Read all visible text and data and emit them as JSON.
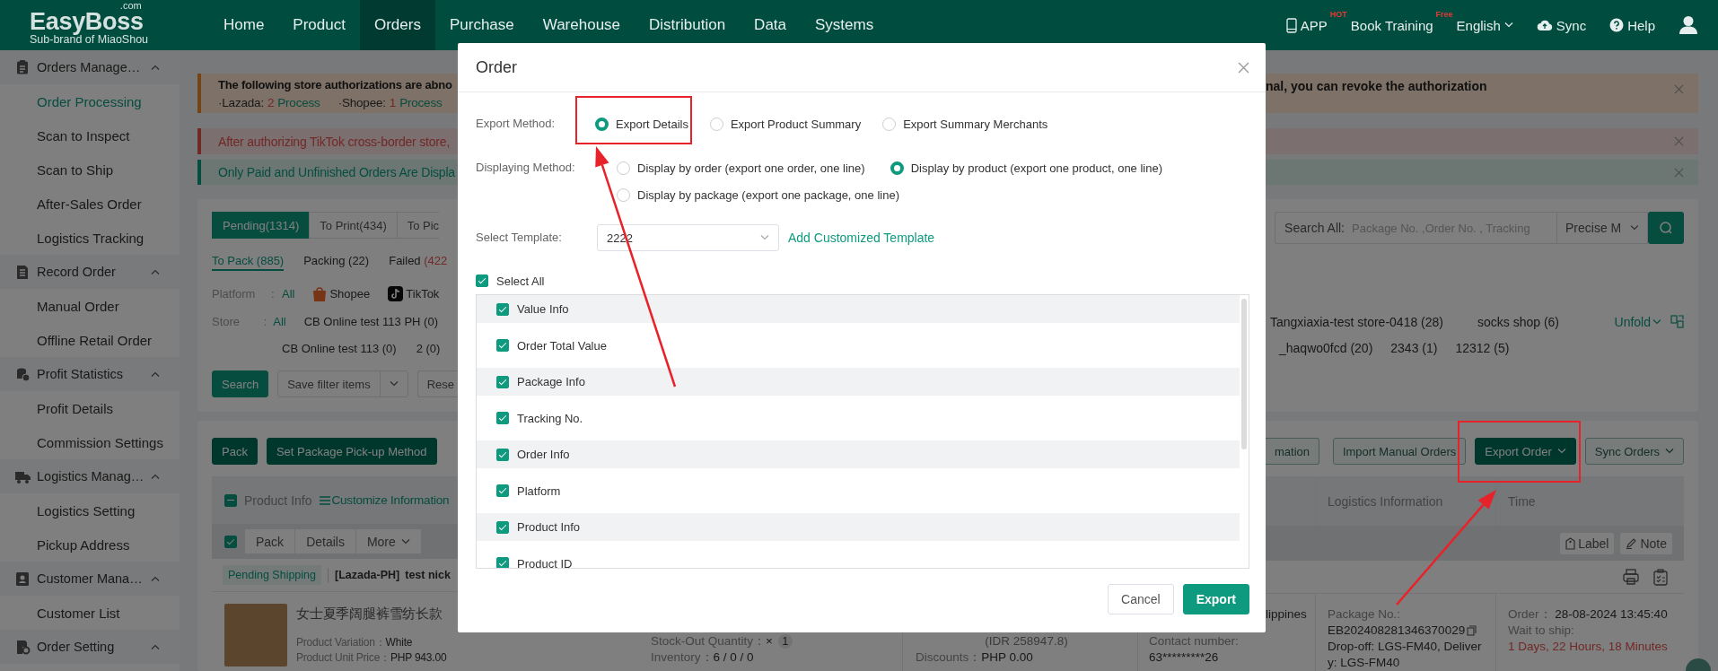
{
  "top_nav": {
    "logo": {
      "name": "EasyBoss",
      "domain": ".com",
      "tagline": "Sub-brand of MiaoShou"
    },
    "items": [
      {
        "label": "Home",
        "selected": false
      },
      {
        "label": "Product",
        "selected": false
      },
      {
        "label": "Orders",
        "selected": true
      },
      {
        "label": "Purchase",
        "selected": false
      },
      {
        "label": "Warehouse",
        "selected": false
      },
      {
        "label": "Distribution",
        "selected": false
      },
      {
        "label": "Data",
        "selected": false
      },
      {
        "label": "Systems",
        "selected": false
      }
    ],
    "tools": [
      {
        "kind": "app",
        "label": "APP",
        "badge": "HOT"
      },
      {
        "kind": "training",
        "label": "Book Training",
        "badge": "Free"
      },
      {
        "kind": "language",
        "label": "English"
      },
      {
        "kind": "sync",
        "label": "Sync"
      },
      {
        "kind": "help",
        "label": "Help"
      },
      {
        "kind": "user"
      }
    ]
  },
  "sidebar": {
    "groups": [
      {
        "label": "Orders Manage…",
        "expanded": true,
        "children": [
          {
            "label": "Order Processing",
            "selected": true
          },
          {
            "label": "Scan to Inspect",
            "selected": false
          },
          {
            "label": "Scan to Ship",
            "selected": false
          },
          {
            "label": "After-Sales Order",
            "selected": false
          },
          {
            "label": "Logistics Tracking",
            "selected": false
          }
        ]
      },
      {
        "label": "Record Order",
        "expanded": true,
        "children": [
          {
            "label": "Manual Order",
            "selected": false
          },
          {
            "label": "Offline Retail Order",
            "selected": false
          }
        ]
      },
      {
        "label": "Profit Statistics",
        "expanded": true,
        "children": [
          {
            "label": "Profit Details",
            "selected": false
          },
          {
            "label": "Commission Settings",
            "selected": false
          }
        ]
      },
      {
        "label": "Logistics Manag…",
        "expanded": true,
        "children": [
          {
            "label": "Logistics Setting",
            "selected": false
          },
          {
            "label": "Pickup Address",
            "selected": false
          }
        ]
      },
      {
        "label": "Customer Mana…",
        "expanded": true,
        "children": [
          {
            "label": "Customer List",
            "selected": false
          }
        ]
      },
      {
        "label": "Order Setting",
        "expanded": true
      }
    ]
  },
  "alerts": [
    {
      "kind": "warning",
      "text": "The following store authorizations are abno",
      "text_continued": "nal, you can revoke the authorization",
      "items": [
        {
          "platform": "·Lazada:",
          "count": "2",
          "action": "Process"
        },
        {
          "platform": "·Shopee:",
          "count": "1",
          "action": "Process"
        }
      ]
    },
    {
      "kind": "error",
      "text": "After authorizing TikTok cross-border store,"
    },
    {
      "kind": "success",
      "text": "Only Paid and Unfinished Orders Are Displa"
    }
  ],
  "filters": {
    "status_tabs": [
      {
        "label": "Pending(1314)",
        "selected": true
      },
      {
        "label": "To Print(434)",
        "selected": false
      },
      {
        "label": "To Pic",
        "selected": false
      }
    ],
    "search": {
      "label": "Search All:",
      "placeholder": "Package No. ,Order No. , Tracking",
      "mode": "Precise M"
    },
    "sub_tabs": [
      {
        "label": "To Pack (885)",
        "selected": true
      },
      {
        "label": "Packing (22)",
        "selected": false
      },
      {
        "label": "Failed",
        "count": "(422",
        "selected": false
      }
    ],
    "platform": {
      "label": "Platform",
      "separator": ":",
      "options": [
        {
          "kind": "all",
          "label": "All",
          "selected": true
        },
        {
          "kind": "shopee",
          "label": "Shopee",
          "selected": false
        },
        {
          "kind": "tiktok",
          "label": "TikTok",
          "selected": false
        }
      ]
    },
    "store": {
      "label": "Store",
      "separator": ":",
      "all": "All",
      "rows": [
        {
          "left": [
            "CB Online test 113 PH (0)"
          ],
          "right": [
            "Tangxiaxia-test store-0418 (28)",
            "socks shop (6)"
          ]
        },
        {
          "left": [
            "CB Online test 113 (0)",
            "2 (0)"
          ],
          "right": [
            "_haqwo0fcd (20)",
            "2343 (1)",
            "12312 (5)"
          ]
        }
      ],
      "unfold": "Unfold"
    },
    "buttons": {
      "search": "Search",
      "save": "Save filter items",
      "reset": "Rese"
    }
  },
  "orders": {
    "toolbar_left": [
      {
        "label": "Pack"
      },
      {
        "label": "Set Package Pick-up Method"
      }
    ],
    "toolbar_right": [
      {
        "kind": "outline",
        "label": "mation",
        "dropdown": false
      },
      {
        "kind": "outline",
        "label": "Import Manual Orders",
        "dropdown": false
      },
      {
        "kind": "primary",
        "label": "Export Order",
        "dropdown": true
      },
      {
        "kind": "outline",
        "label": "Sync Orders",
        "dropdown": true
      }
    ],
    "columns": {
      "header_indeterminate": true,
      "product": "Product Info",
      "customize": "Customize Information",
      "logistics": "Logistics Information",
      "time": "Time"
    },
    "batch_checked": true,
    "batch_actions": [
      {
        "label": "Pack",
        "dropdown": false
      },
      {
        "label": "Details",
        "dropdown": false
      },
      {
        "label": "More",
        "dropdown": true
      }
    ],
    "tag_actions": [
      {
        "kind": "label",
        "label": "Label"
      },
      {
        "kind": "note",
        "label": "Note"
      }
    ],
    "order": {
      "status": "Pending Shipping",
      "store": "[Lazada-PH]",
      "buyer": "test nick",
      "product": {
        "title": "女士夏季阔腿裤雪纺长款",
        "variation": {
          "label": "Product Variation：",
          "value": "White"
        },
        "unit_price": {
          "label": "Product Unit Price：",
          "value": "PHP 943.00"
        },
        "stock_out": {
          "label": "Stock-Out Quantity：",
          "value": "×",
          "count": "1"
        },
        "inventory": {
          "label": "Inventory：",
          "value": "6 / 0 / 0"
        }
      },
      "amount": "(IDR 258947.8)",
      "discounts": {
        "label": "Discounts：",
        "value": "PHP 0.00"
      },
      "contact": {
        "label": "Contact number:",
        "value": "63*********26"
      },
      "country": "lippines",
      "logistics": {
        "label": "Package No.:",
        "package_no": "EB202408281346370029",
        "route": "Drop-off: LGS-FM40, Delivery: LGS-FM40"
      },
      "time": {
        "label": "Order：",
        "value": "28-08-2024 13:45:40",
        "wait": "Wait to ship:",
        "remaining": "1 Days, 22 Hours, 18 Minutes"
      }
    }
  },
  "dialog": {
    "title": "Order",
    "export_method": {
      "label": "Export Method:",
      "options": [
        {
          "label": "Export Details",
          "selected": true
        },
        {
          "label": "Export Product Summary",
          "selected": false
        },
        {
          "label": "Export Summary Merchants",
          "selected": false
        }
      ]
    },
    "display_method": {
      "label": "Displaying Method:",
      "options": [
        {
          "label": "Display by order (export one order, one line)",
          "selected": false
        },
        {
          "label": "Display by product (export one product, one line)",
          "selected": true
        },
        {
          "label": "Display by package (export one package, one line)",
          "selected": false
        }
      ]
    },
    "template": {
      "label": "Select Template:",
      "value": "2222",
      "link": "Add Customized Template"
    },
    "select_all": {
      "label": "Select All",
      "checked": true
    },
    "fields": [
      {
        "kind": "group",
        "label": "Value Info",
        "checked": true
      },
      {
        "kind": "field",
        "label": "Order Total Value",
        "checked": true
      },
      {
        "kind": "group",
        "label": "Package Info",
        "checked": true
      },
      {
        "kind": "field",
        "label": "Tracking No.",
        "checked": true
      },
      {
        "kind": "group",
        "label": "Order Info",
        "checked": true
      },
      {
        "kind": "field",
        "label": "Platform",
        "checked": true
      },
      {
        "kind": "group",
        "label": "Product Info",
        "checked": true
      },
      {
        "kind": "field",
        "label": "Product ID",
        "checked": true
      }
    ],
    "buttons": [
      {
        "kind": "secondary",
        "label": "Cancel"
      },
      {
        "kind": "primary",
        "label": "Export"
      }
    ]
  }
}
